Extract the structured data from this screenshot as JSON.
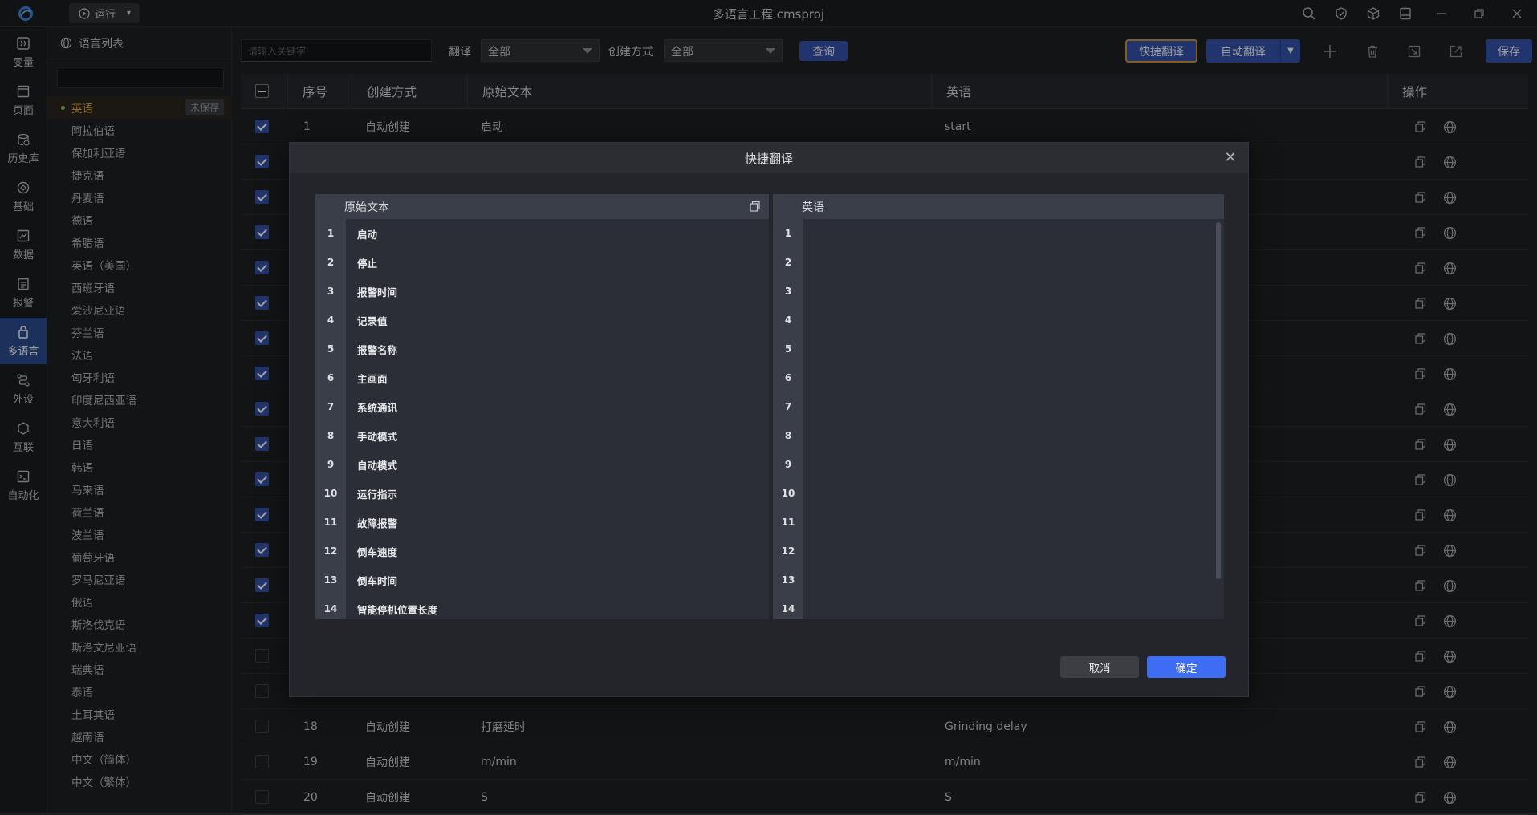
{
  "titlebar": {
    "title": "多语言工程.cmsproj",
    "run_label": "运行"
  },
  "nav": [
    {
      "label": "变量",
      "icon": "variable-icon"
    },
    {
      "label": "页面",
      "icon": "page-icon"
    },
    {
      "label": "历史库",
      "icon": "history-icon"
    },
    {
      "label": "基础",
      "icon": "basic-icon"
    },
    {
      "label": "数据",
      "icon": "data-icon"
    },
    {
      "label": "报警",
      "icon": "alarm-icon"
    },
    {
      "label": "多语言",
      "icon": "multilang-icon",
      "active": true
    },
    {
      "label": "外设",
      "icon": "peripheral-icon"
    },
    {
      "label": "互联",
      "icon": "interconnect-icon"
    },
    {
      "label": "自动化",
      "icon": "automation-icon"
    }
  ],
  "langpanel": {
    "title": "语言列表",
    "unsaved_badge": "未保存",
    "languages": [
      "英语",
      "阿拉伯语",
      "保加利亚语",
      "捷克语",
      "丹麦语",
      "德语",
      "希腊语",
      "英语（美国）",
      "西班牙语",
      "爱沙尼亚语",
      "芬兰语",
      "法语",
      "匈牙利语",
      "印度尼西亚语",
      "意大利语",
      "日语",
      "韩语",
      "马来语",
      "荷兰语",
      "波兰语",
      "葡萄牙语",
      "罗马尼亚语",
      "俄语",
      "斯洛伐克语",
      "斯洛文尼亚语",
      "瑞典语",
      "泰语",
      "土耳其语",
      "越南语",
      "中文（简体）",
      "中文（繁体）"
    ]
  },
  "toolbar": {
    "keyword_placeholder": "请输入关键字",
    "translate_label": "翻译",
    "translate_value": "全部",
    "create_label": "创建方式",
    "create_value": "全部",
    "query_label": "查询",
    "quick_translate_label": "快捷翻译",
    "auto_translate_label": "自动翻译",
    "save_label": "保存"
  },
  "table": {
    "headers": {
      "index": "序号",
      "create": "创建方式",
      "source": "原始文本",
      "target": "英语",
      "ops": "操作"
    },
    "rows": [
      {
        "index": "1",
        "create": "自动创建",
        "source": "启动",
        "target": "start",
        "checked": true
      },
      {
        "checked": true
      },
      {
        "checked": true
      },
      {
        "checked": true
      },
      {
        "checked": true
      },
      {
        "checked": true
      },
      {
        "checked": true
      },
      {
        "checked": true
      },
      {
        "checked": true
      },
      {
        "checked": true
      },
      {
        "checked": true
      },
      {
        "checked": true
      },
      {
        "checked": true
      },
      {
        "checked": true
      },
      {
        "checked": true
      },
      {
        "checked": false
      },
      {
        "checked": false
      },
      {
        "index": "18",
        "create": "自动创建",
        "source": "打磨延时",
        "target": "Grinding delay",
        "checked": false
      },
      {
        "index": "19",
        "create": "自动创建",
        "source": "m/min",
        "target": "m/min",
        "checked": false
      },
      {
        "index": "20",
        "create": "自动创建",
        "source": "S",
        "target": "S",
        "checked": false
      }
    ]
  },
  "modal": {
    "title": "快捷翻译",
    "source_header": "原始文本",
    "target_header": "英语",
    "source_lines": [
      "启动",
      "停止",
      "报警时间",
      "记录值",
      "报警名称",
      "主画面",
      "系统通讯",
      "手动模式",
      "自动模式",
      "运行指示",
      "故障报警",
      "倒车速度",
      "倒车时间",
      "智能停机位置长度"
    ],
    "line_numbers": [
      "1",
      "2",
      "3",
      "4",
      "5",
      "6",
      "7",
      "8",
      "9",
      "10",
      "11",
      "12",
      "13",
      "14"
    ],
    "cancel_label": "取消",
    "ok_label": "确定"
  }
}
